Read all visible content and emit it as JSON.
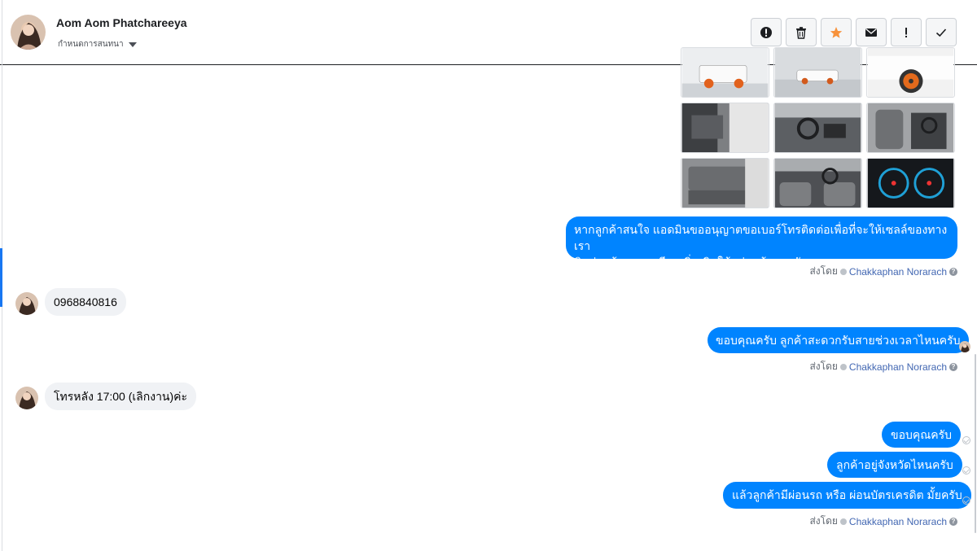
{
  "header": {
    "contact_name": "Aom Aom Phatchareeya",
    "assign_label": "กำหนดการสนทนา"
  },
  "toolbar": {
    "buttons": [
      {
        "name": "mark-spam",
        "icon": "alert-circle-icon"
      },
      {
        "name": "delete",
        "icon": "trash-icon"
      },
      {
        "name": "star",
        "icon": "star-icon",
        "color": "#f7923b"
      },
      {
        "name": "mark-unread",
        "icon": "envelope-icon"
      },
      {
        "name": "follow-up",
        "icon": "exclamation-icon"
      },
      {
        "name": "mark-done",
        "icon": "check-icon"
      }
    ]
  },
  "conversation": {
    "out_message_1": "หากลูกค้าสนใจ แอดมินขออนุญาตขอเบอร์โทรติดต่อเพื่อที่จะให้เซลล์ของทางเรา",
    "out_message_1_line2": "ติดต่อแจ้งรายละเอียดเพิ่มเติมให้แก่ลูกค้านะครับ",
    "sent_by_label": "ส่งโดย",
    "agent_name": "Chakkaphan Norarach",
    "in_message_1": "0968840816",
    "out_message_2": "ขอบคุณครับ ลูกค้าสะดวกรับสายช่วงเวลาไหนครับ",
    "in_message_2": "โทรหลัง 17:00 (เลิกงาน)ค่ะ",
    "out_message_3": "ขอบคุณครับ",
    "out_message_4": "ลูกค้าอยู่จังหวัดไหนครับ",
    "out_message_5": "แล้วลูกค้ามีผ่อนรถ หรือ ผ่อนบัตรเครดิต มั้ยครับ"
  },
  "colors": {
    "bubble_out": "#0084ff",
    "bubble_in": "#f0f2f5",
    "agent_link": "#4267b2",
    "accent": "#1877f2"
  }
}
